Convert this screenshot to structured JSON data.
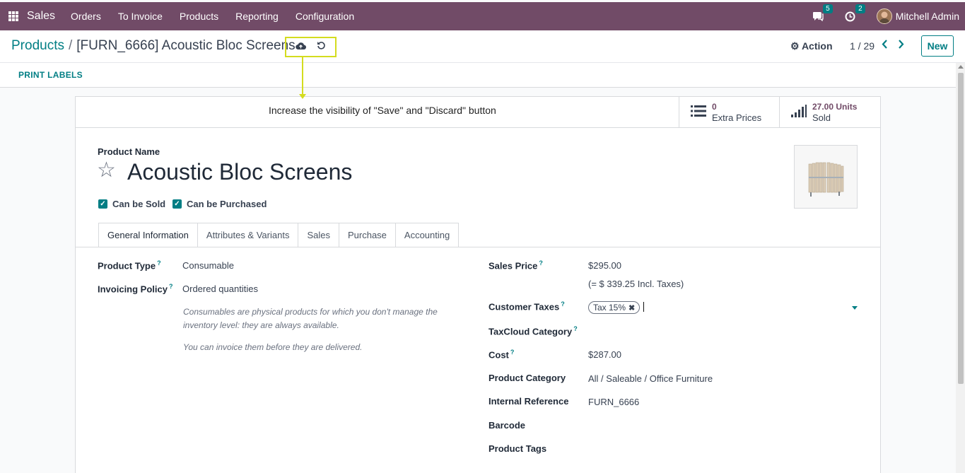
{
  "navbar": {
    "app_name": "Sales",
    "menu": [
      "Orders",
      "To Invoice",
      "Products",
      "Reporting",
      "Configuration"
    ],
    "messages_count": "5",
    "activities_count": "2",
    "user_name": "Mitchell Admin"
  },
  "control": {
    "breadcrumb_parent": "Products",
    "breadcrumb_current": "[FURN_6666] Acoustic Bloc Screens",
    "action_label": "Action",
    "pager": "1 / 29",
    "new_label": "New"
  },
  "statusbar": {
    "print_labels": "PRINT LABELS"
  },
  "annotation": {
    "text": "Increase the visibility of \"Save\" and \"Discard\" button",
    "color": "#d4dc1f"
  },
  "smart_buttons": {
    "extra_prices_value": "0",
    "extra_prices_label": "Extra Prices",
    "sold_value": "27.00 Units",
    "sold_label": "Sold"
  },
  "product": {
    "name_label": "Product Name",
    "name": "Acoustic Bloc Screens",
    "can_be_sold": "Can be Sold",
    "can_be_purchased": "Can be Purchased"
  },
  "tabs": [
    "General Information",
    "Attributes & Variants",
    "Sales",
    "Purchase",
    "Accounting"
  ],
  "general": {
    "product_type_label": "Product Type",
    "product_type": "Consumable",
    "invoicing_policy_label": "Invoicing Policy",
    "invoicing_policy": "Ordered quantities",
    "help_1a": "Consumables are physical products for which you don't manage the",
    "help_1b": "inventory level: they are always available.",
    "help_2": "You can invoice them before they are delivered.",
    "sales_price_label": "Sales Price",
    "sales_price": "$295.00",
    "sales_price_incl": "(= $ 339.25 Incl. Taxes)",
    "customer_taxes_label": "Customer Taxes",
    "customer_tax_tag": "Tax 15%",
    "taxcloud_label": "TaxCloud Category",
    "cost_label": "Cost",
    "cost": "$287.00",
    "category_label": "Product Category",
    "category": "All / Saleable / Office Furniture",
    "internal_ref_label": "Internal Reference",
    "internal_ref": "FURN_6666",
    "barcode_label": "Barcode",
    "product_tags_label": "Product Tags",
    "help_marker": "?"
  },
  "colors": {
    "navbar": "#714b67",
    "accent": "#017e84"
  }
}
